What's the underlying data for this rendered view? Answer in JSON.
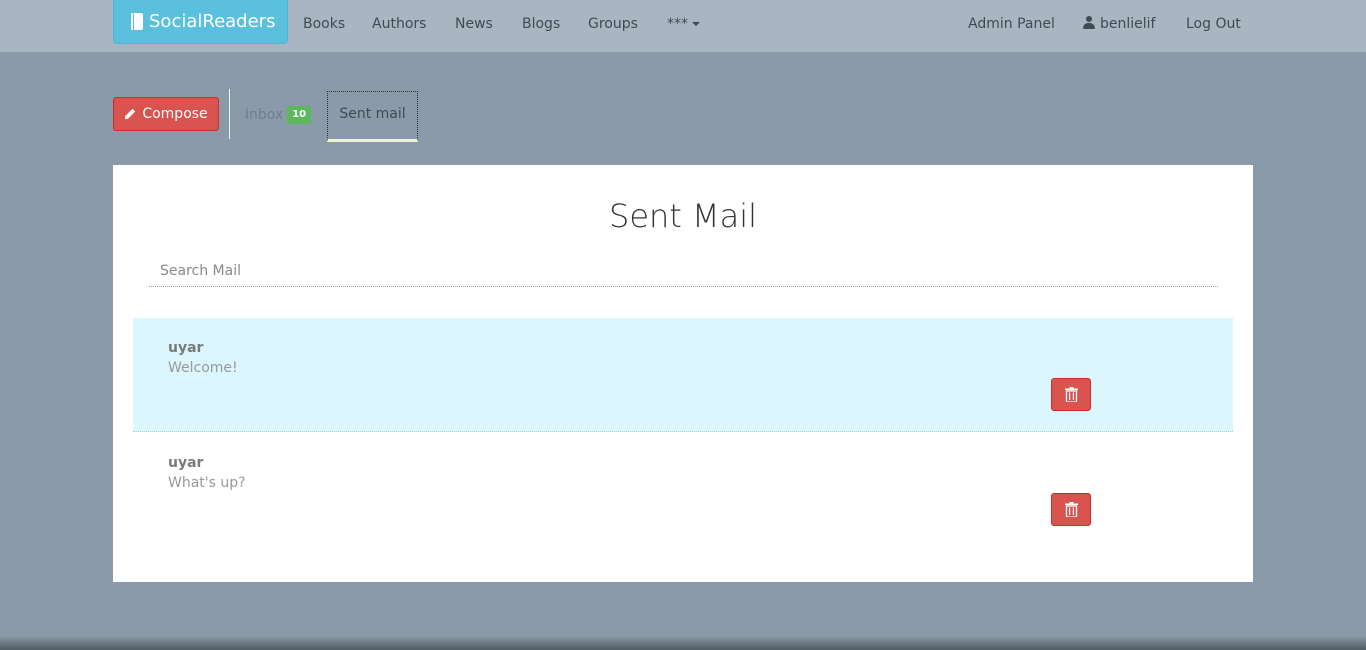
{
  "navbar": {
    "brand": "SocialReaders",
    "links": [
      "Books",
      "Authors",
      "News",
      "Blogs",
      "Groups"
    ],
    "more": "***",
    "admin": "Admin Panel",
    "user": "benlielif",
    "logout": "Log Out"
  },
  "tabs": {
    "compose": "Compose",
    "inbox": "Inbox",
    "inbox_count": "10",
    "sent": "Sent mail"
  },
  "page": {
    "title": "Sent Mail",
    "search_placeholder": "Search Mail"
  },
  "messages": [
    {
      "from": "uyar",
      "subject": "Welcome!"
    },
    {
      "from": "uyar",
      "subject": "What's up?"
    }
  ],
  "colors": {
    "brand": "#5bc0de",
    "danger": "#d9534f",
    "badge": "#5cb85c",
    "highlight_row": "#dbf6fc"
  }
}
